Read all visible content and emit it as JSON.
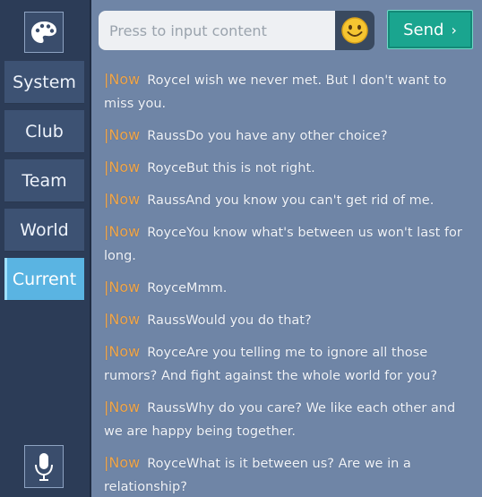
{
  "input": {
    "placeholder": "Press to input content",
    "value": ""
  },
  "send_label": "Send",
  "tabs": [
    {
      "label": "System"
    },
    {
      "label": "Club"
    },
    {
      "label": "Team"
    },
    {
      "label": "World"
    },
    {
      "label": "Current",
      "active": true
    }
  ],
  "messages": [
    {
      "tag": "Now",
      "sender": "Royce",
      "text": "I wish we never met. But I don't want to miss you."
    },
    {
      "tag": "Now",
      "sender": "Rauss",
      "text": "Do you have any other choice?"
    },
    {
      "tag": "Now",
      "sender": "Royce",
      "text": "But this is not right."
    },
    {
      "tag": "Now",
      "sender": "Rauss",
      "text": "And you know you can't get rid of me."
    },
    {
      "tag": "Now",
      "sender": "Royce",
      "text": "You know what's between us won't last for long."
    },
    {
      "tag": "Now",
      "sender": "Royce",
      "text": "Mmm."
    },
    {
      "tag": "Now",
      "sender": "Rauss",
      "text": "Would you do that?"
    },
    {
      "tag": "Now",
      "sender": "Royce",
      "text": "Are you telling me to ignore all those rumors? And fight against the whole world for you?"
    },
    {
      "tag": "Now",
      "sender": "Rauss",
      "text": "Why do you care? We like each other and we are happy being together."
    },
    {
      "tag": "Now",
      "sender": "Royce",
      "text": "What is it between us? Are we in a relationship?"
    }
  ],
  "colors": {
    "accent_tab": "#5ab4e2",
    "send_button": "#1aa58f",
    "channel_tag": "#f0a64a"
  },
  "icons": [
    "palette-icon",
    "smiley-icon",
    "chevron-right-icon",
    "microphone-icon"
  ]
}
